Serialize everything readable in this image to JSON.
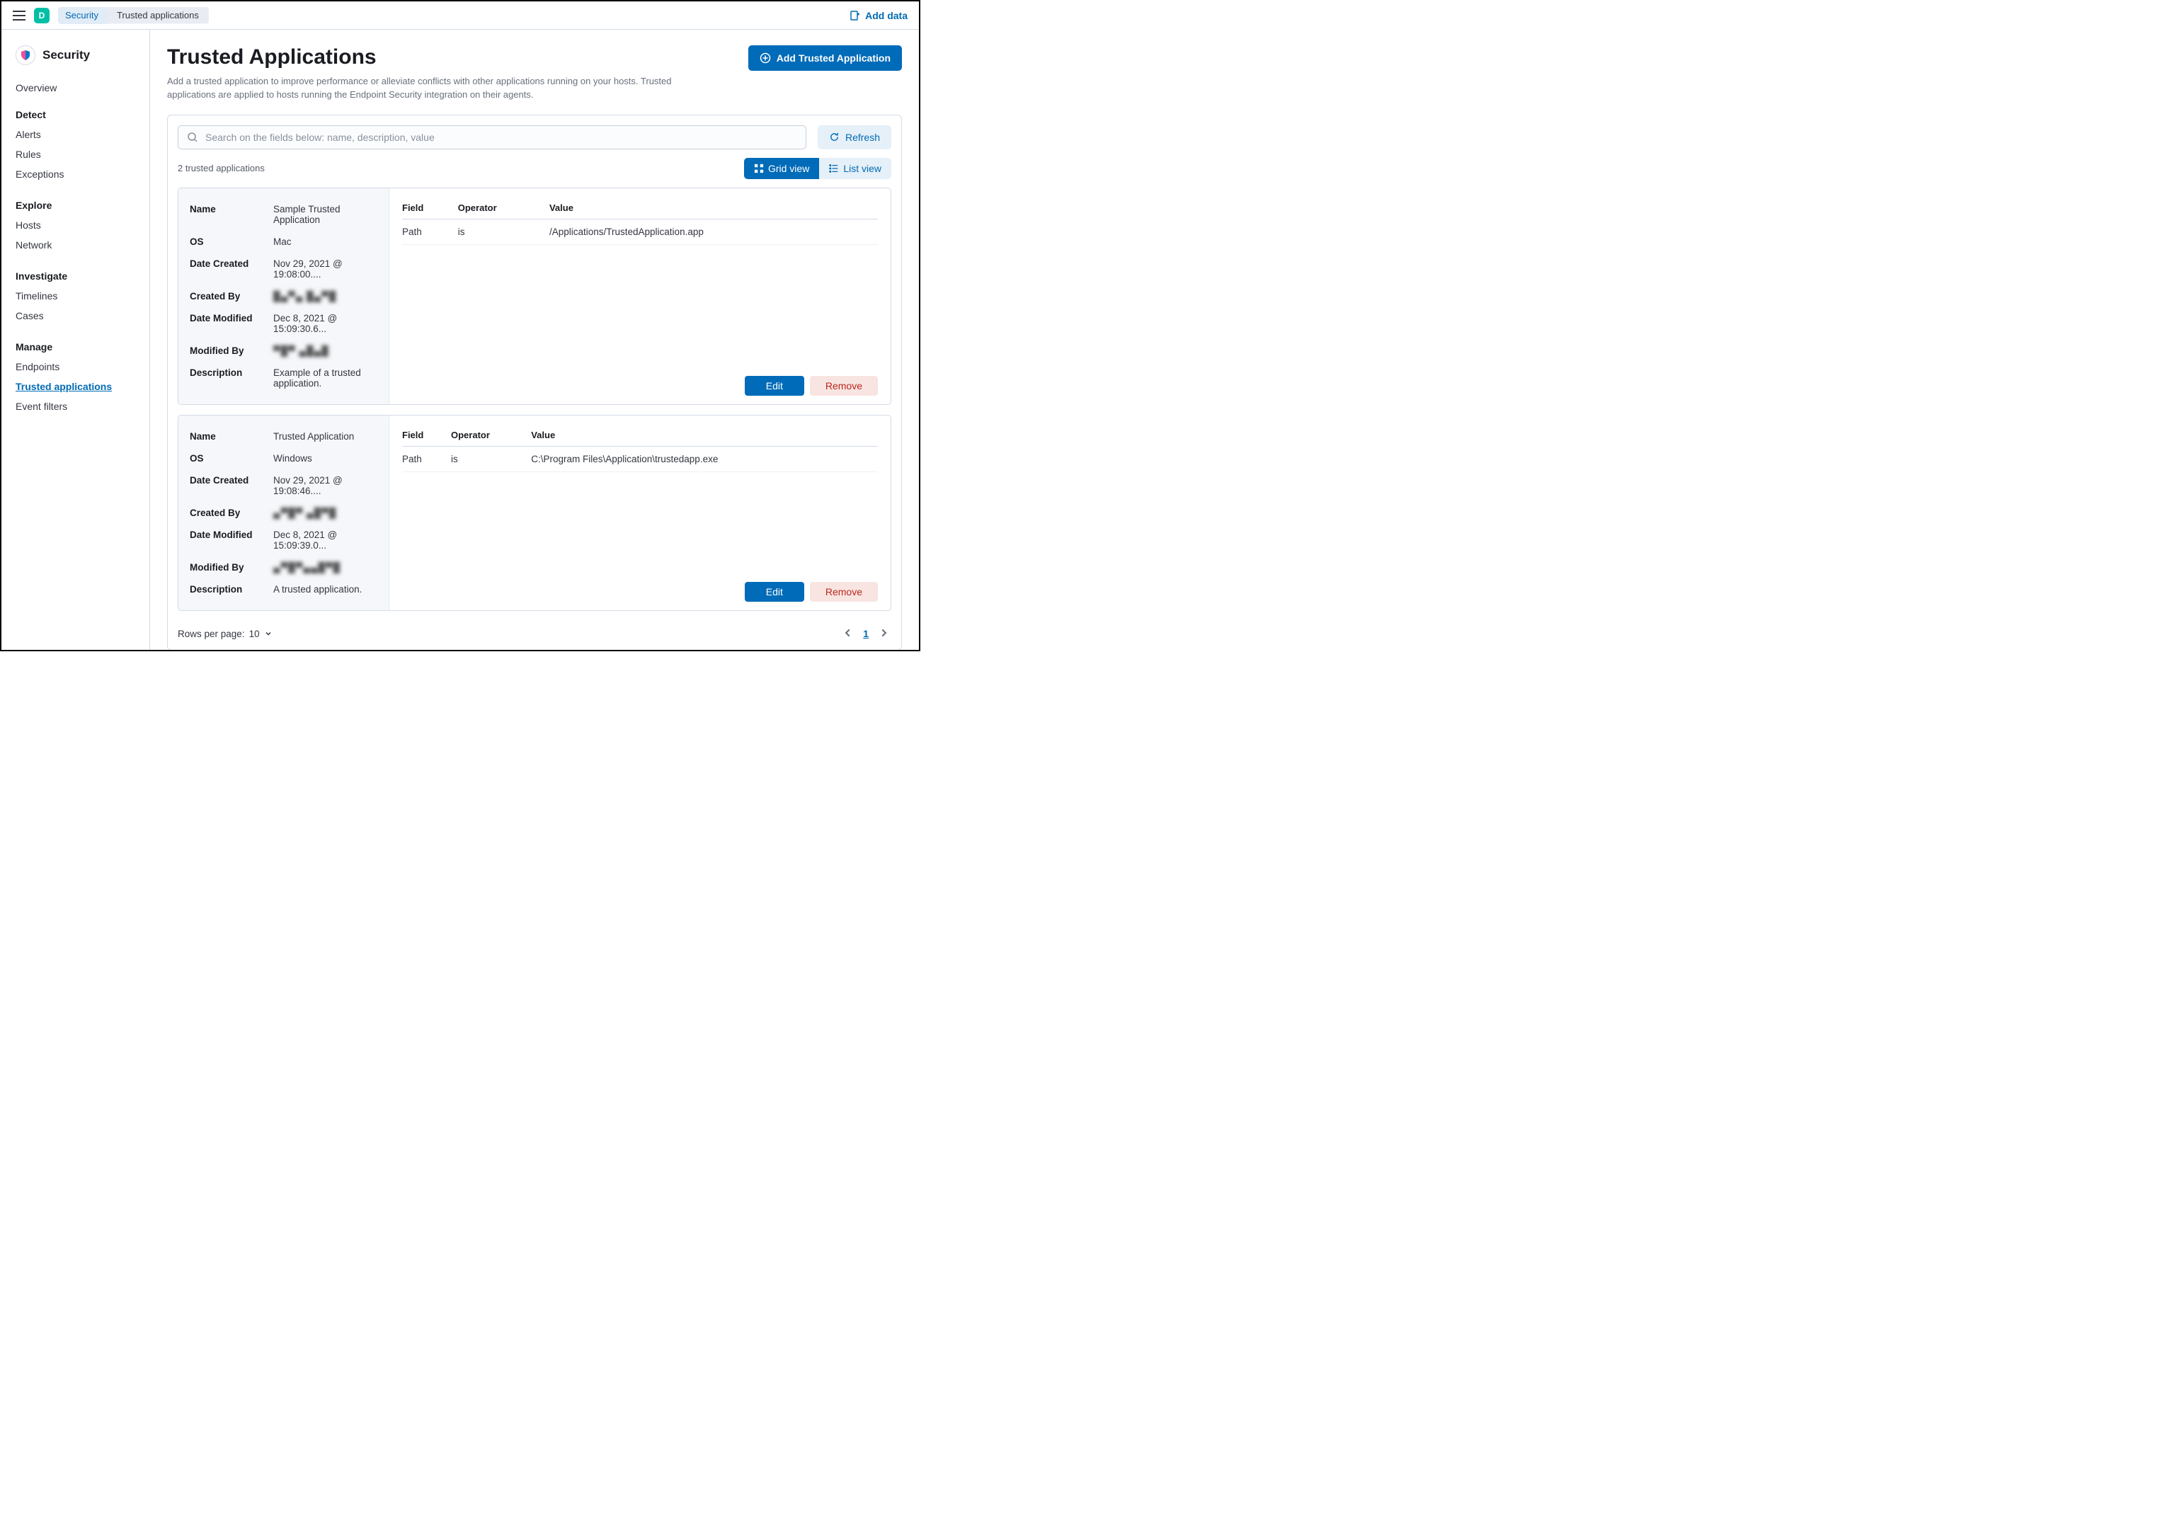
{
  "topbar": {
    "space_letter": "D",
    "crumb_security": "Security",
    "crumb_current": "Trusted applications",
    "add_data": "Add data"
  },
  "sidebar": {
    "app": "Security",
    "overview": "Overview",
    "groups": {
      "detect": {
        "title": "Detect",
        "alerts": "Alerts",
        "rules": "Rules",
        "exceptions": "Exceptions"
      },
      "explore": {
        "title": "Explore",
        "hosts": "Hosts",
        "network": "Network"
      },
      "investigate": {
        "title": "Investigate",
        "timelines": "Timelines",
        "cases": "Cases"
      },
      "manage": {
        "title": "Manage",
        "endpoints": "Endpoints",
        "trusted": "Trusted applications",
        "event_filters": "Event filters"
      }
    }
  },
  "page": {
    "title": "Trusted Applications",
    "description": "Add a trusted application to improve performance or alleviate conflicts with other applications running on your hosts. Trusted applications are applied to hosts running the Endpoint Security integration on their agents.",
    "add_button": "Add Trusted Application"
  },
  "controls": {
    "search_placeholder": "Search on the fields below: name, description, value",
    "refresh": "Refresh",
    "count_text": "2 trusted applications",
    "grid_view": "Grid view",
    "list_view": "List view"
  },
  "labels": {
    "name": "Name",
    "os": "OS",
    "date_created": "Date Created",
    "created_by": "Created By",
    "date_modified": "Date Modified",
    "modified_by": "Modified By",
    "description": "Description",
    "field": "Field",
    "operator": "Operator",
    "value": "Value",
    "edit": "Edit",
    "remove": "Remove"
  },
  "cards": [
    {
      "name": "Sample Trusted Application",
      "os": "Mac",
      "date_created": "Nov 29, 2021 @ 19:08:00....",
      "created_by": "█▄▀▄  █▄▀█",
      "date_modified": "Dec 8, 2021 @ 15:09:30.6...",
      "modified_by": "▀█▀  ▄█▄█",
      "description": "Example of a trusted application.",
      "conditions": [
        {
          "field": "Path",
          "operator": "is",
          "value": "/Applications/TrustedApplication.app"
        }
      ]
    },
    {
      "name": "Trusted Application",
      "os": "Windows",
      "date_created": "Nov 29, 2021 @ 19:08:46....",
      "created_by": "▄▀█▀  ▄█▀█",
      "date_modified": "Dec 8, 2021 @ 15:09:39.0...",
      "modified_by": "▄▀█▀▄▄█▀█",
      "description": "A trusted application.",
      "conditions": [
        {
          "field": "Path",
          "operator": "is",
          "value": "C:\\Program Files\\Application\\trustedapp.exe"
        }
      ]
    }
  ],
  "footer": {
    "rows_per_page_label": "Rows per page:",
    "rows_per_page_value": "10",
    "current_page": "1"
  }
}
